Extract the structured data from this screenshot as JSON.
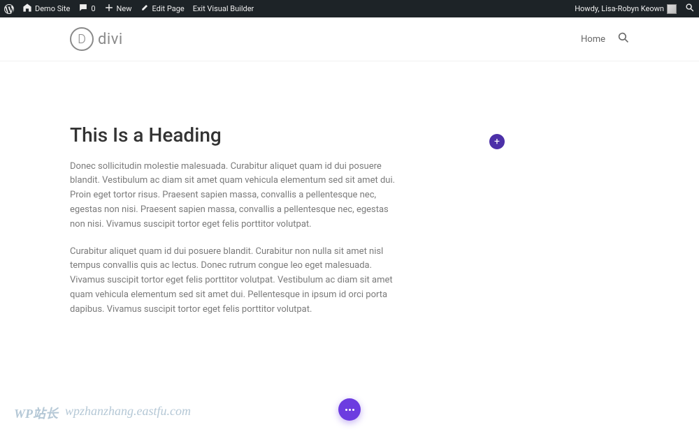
{
  "adminBar": {
    "siteName": "Demo Site",
    "comments": "0",
    "new": "New",
    "editPage": "Edit Page",
    "exitBuilder": "Exit Visual Builder",
    "greeting": "Howdy, Lisa-Robyn Keown"
  },
  "header": {
    "logoLetter": "D",
    "logoText": "divi",
    "nav": {
      "home": "Home"
    }
  },
  "content": {
    "heading": "This Is a Heading",
    "para1": "Donec sollicitudin molestie malesuada. Curabitur aliquet quam id dui posuere blandit. Vestibulum ac diam sit amet quam vehicula elementum sed sit amet dui. Proin eget tortor risus. Praesent sapien massa, convallis a pellentesque nec, egestas non nisi. Praesent sapien massa, convallis a pellentesque nec, egestas non nisi. Vivamus suscipit tortor eget felis porttitor volutpat.",
    "para2": "Curabitur aliquet quam id dui posuere blandit. Curabitur non nulla sit amet nisl tempus convallis quis ac lectus. Donec rutrum congue leo eget malesuada. Vivamus suscipit tortor eget felis porttitor volutpat. Vestibulum ac diam sit amet quam vehicula elementum sed sit amet dui. Pellentesque in ipsum id orci porta dapibus. Vivamus suscipit tortor eget felis porttitor volutpat."
  },
  "watermark": {
    "text1": "WP站长",
    "text2": "wpzhanzhang.eastfu.com"
  }
}
